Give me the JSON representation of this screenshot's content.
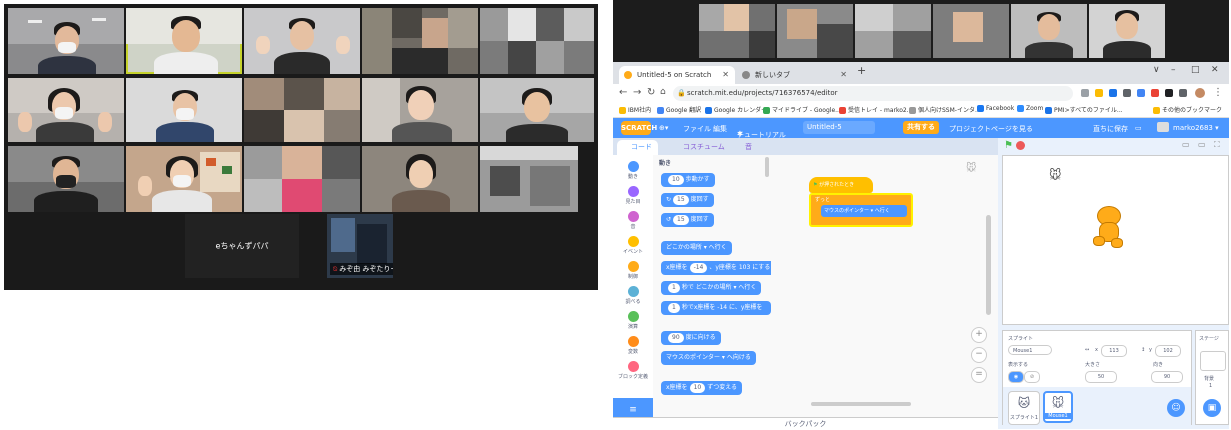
{
  "zoom_meeting": {
    "center_tile_name": "eちゃんずパパ",
    "speaker_chip_name": "みぞ由 みぞたりーじー"
  },
  "browser": {
    "tabs": [
      {
        "label": "Untitled-5 on Scratch",
        "active": true
      },
      {
        "label": "新しいタブ",
        "active": false
      }
    ],
    "new_tab": "+",
    "url": "scratch.mit.edu/projects/716376574/editor",
    "bookmarks": [
      "IBM社内",
      "Google 翻訳",
      "Google カレンダー",
      "マイドライブ - Google...",
      "受信トレイ - marko2...",
      "個人向けSSM-インタ...",
      "Facebook",
      "Zoom",
      "PMI>すべてのファイル..."
    ],
    "other_bookmarks": "その他のブックマーク",
    "window_controls": [
      "∨",
      "–",
      "□",
      "✕"
    ]
  },
  "scratch": {
    "logo": "SCRATCH",
    "menu": {
      "globe": "⊕▾",
      "file": "ファイル",
      "edit": "編集",
      "tutorials": "チュートリアル",
      "project_title": "Untitled-5",
      "share": "共有する",
      "project_page": "プロジェクトページを見る",
      "saved": "直ちに保存",
      "username": "marko2683 ▾"
    },
    "editor_tabs": {
      "code": "コード",
      "costumes": "コスチューム",
      "sounds": "音"
    },
    "categories": [
      {
        "label": "動き",
        "color": "#4c97ff"
      },
      {
        "label": "見た目",
        "color": "#9966ff"
      },
      {
        "label": "音",
        "color": "#cf63cf"
      },
      {
        "label": "イベント",
        "color": "#ffbf00"
      },
      {
        "label": "制御",
        "color": "#ffab19"
      },
      {
        "label": "調べる",
        "color": "#5cb1d6"
      },
      {
        "label": "演算",
        "color": "#59c059"
      },
      {
        "label": "変数",
        "color": "#ff8c1a"
      },
      {
        "label": "ブロック定義",
        "color": "#ff6680"
      }
    ],
    "palette": {
      "heading": "動き",
      "blocks": [
        {
          "pre": "",
          "num": "10",
          "post": "歩動かす"
        },
        {
          "pre": "↻",
          "num": "15",
          "post": "度回す"
        },
        {
          "pre": "↺",
          "num": "15",
          "post": "度回す"
        },
        {
          "pre": "",
          "num": "",
          "post": "どこかの場所 ▾ へ行く"
        },
        {
          "pre": "x座標を",
          "num": "-14",
          "post": "、y座標を 103 にする"
        },
        {
          "pre": "",
          "num": "1",
          "post": "秒で どこかの場所 ▾ へ行く"
        },
        {
          "pre": "",
          "num": "1",
          "post": "秒でx座標を -14 に、y座標を"
        },
        {
          "pre": "",
          "num": "90",
          "post": "度に向ける"
        },
        {
          "pre": "",
          "num": "",
          "post": "マウスのポインター ▾ へ向ける"
        },
        {
          "pre": "x座標を",
          "num": "10",
          "post": "ずつ変える"
        }
      ]
    },
    "script": {
      "hat": "が押されたとき",
      "forever": "ずっと",
      "goto": "マウスのポインター ▾ へ行く"
    },
    "backpack": "バックパック",
    "sprite_panel": {
      "sprite_label": "スプライト",
      "sprite_name": "Mouse1",
      "x_label": "x",
      "x_value": "113",
      "y_label": "y",
      "y_value": "102",
      "show_label": "表示する",
      "size_label": "大きさ",
      "size_value": "50",
      "direction_label": "向き",
      "direction_value": "90",
      "thumbs": [
        "スプライト1",
        "Mouse1"
      ]
    },
    "stage_panel": {
      "label": "ステージ",
      "backdrops_label": "背景",
      "backdrops_count": "1"
    },
    "zoom_controls": [
      "+",
      "−",
      "="
    ]
  }
}
